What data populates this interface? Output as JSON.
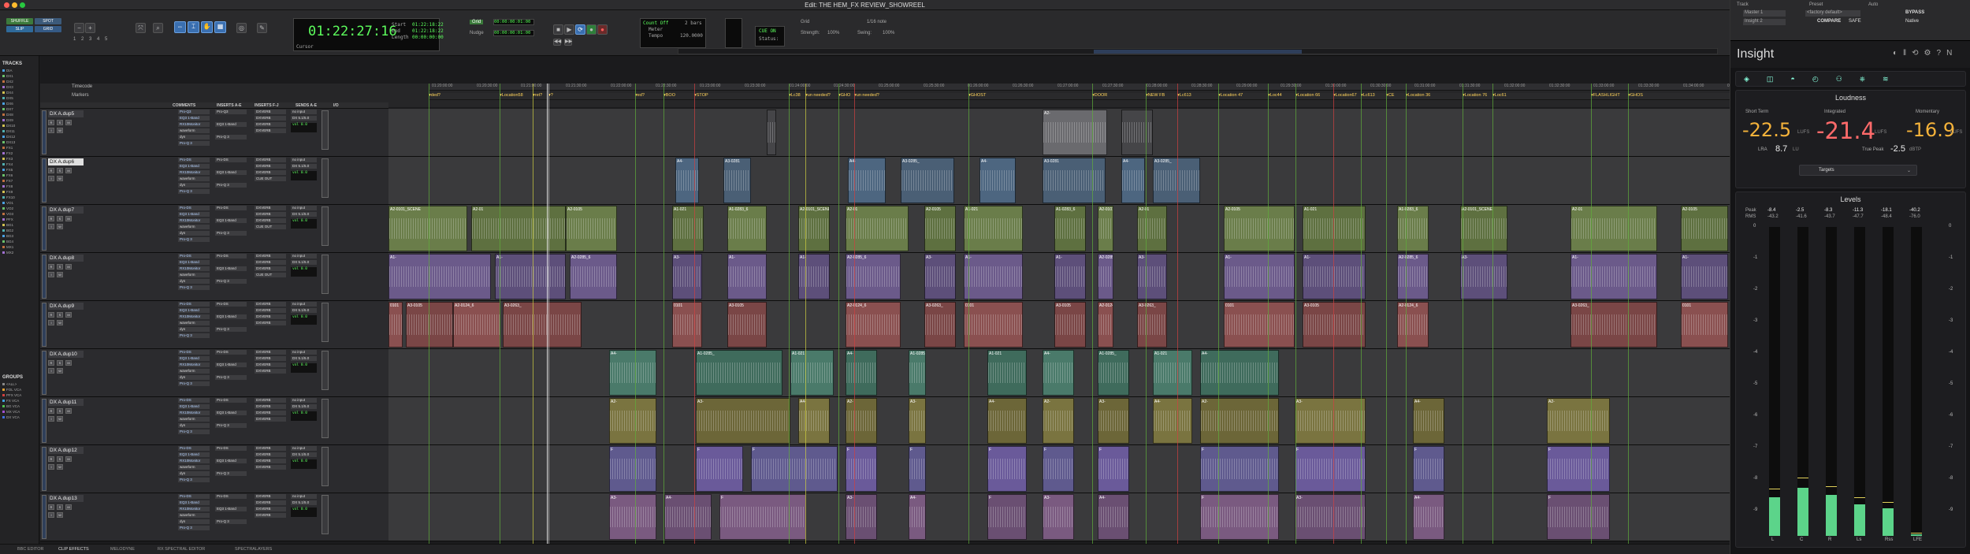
{
  "window": {
    "title": "Edit: THE HEM_FX REVIEW_SHOWREEL"
  },
  "toolbar": {
    "modes": [
      "SHUFFLE",
      "SPOT",
      "SLIP",
      "GRID"
    ],
    "counter_main": "01:22:27:16",
    "counter_cursor_label": "Cursor",
    "start_label": "Start",
    "end_label": "End",
    "length_label": "Length",
    "start": "01:22:18:22",
    "end": "01:22:18:22",
    "length": "00:00:00:00",
    "nudge_label": "Nudge",
    "grid_label": "Grid",
    "nudge_value": "00:00:00:01:00",
    "grid_value": "00:00:00:01:00",
    "count_off": "Count Off",
    "meter": "Meter",
    "tempo": "Tempo",
    "bars": "2 bars",
    "tempo_val": "120.0000",
    "grid_rate": "1/16 note",
    "strength": "Strength:",
    "strength_val": "100%",
    "swing": "Swing:",
    "swing_val": "100%",
    "cue_on": "CUE ON",
    "status": "Status:",
    "numbers": [
      "1",
      "2",
      "3",
      "4",
      "5"
    ]
  },
  "left_panel": {
    "tracks_title": "TRACKS",
    "track_list": [
      "DIA",
      "DX1",
      "DX2",
      "DX3",
      "DX4",
      "DX5",
      "DX6",
      "DX7",
      "DX8",
      "DX9",
      "DX10",
      "DX11",
      "DX12",
      "DX13",
      "FX1",
      "FX2",
      "FX3",
      "FX4",
      "FX5",
      "FX6",
      "FX7",
      "FX8",
      "FX9",
      "FX10",
      "VO1",
      "VO2",
      "VO3",
      "PFX",
      "BG1",
      "BG2",
      "BG3",
      "BG4",
      "MX1",
      "MX2"
    ],
    "groups_title": "GROUPS",
    "groups": [
      "<ALL>",
      "FOL VCA",
      "PFX VCA",
      "FX VCA",
      "BG VCA",
      "MX VCA",
      "DX VCA"
    ]
  },
  "rulers": {
    "timecode": "Timecode",
    "markers": "Markers"
  },
  "ruler_ticks": [
    "01:20:00:00",
    "01:20:30:00",
    "01:21:00:00",
    "01:21:30:00",
    "01:22:00:00",
    "01:22:30:00",
    "01:23:00:00",
    "01:23:30:00",
    "01:24:00:00",
    "01:24:30:00",
    "01:25:00:00",
    "01:25:30:00",
    "01:26:00:00",
    "01:26:30:00",
    "01:27:00:00",
    "01:27:30:00",
    "01:28:00:00",
    "01:28:30:00",
    "01:29:00:00",
    "01:29:30:00",
    "01:30:00:00",
    "01:30:30:00",
    "01:31:00:00",
    "01:31:30:00",
    "01:32:00:00",
    "01:32:30:00",
    "01:33:00:00",
    "01:33:30:00",
    "01:34:00:00",
    "01:34:30:00"
  ],
  "markers": [
    "ded?",
    "Location58",
    "ret?",
    "?",
    "ed?",
    "BOO",
    "STOP",
    "Lc38",
    "un needed?",
    "GHO",
    "un needed?",
    "GHOST",
    "DOOR",
    "NEW FB",
    "Lc613",
    "Location 47",
    "Loc44",
    "Location 66",
    "Location67",
    "Lc613",
    "CE",
    "Location 36",
    "Location 76",
    "Loc61",
    "FLASHLIGHT",
    "GHOS"
  ],
  "columns": {
    "comments": "COMMENTS",
    "inserts_ae": "INSERTS A-E",
    "inserts_fj": "INSERTS F-J",
    "sends": "SENDS A-E",
    "io": "I/O"
  },
  "tracks": [
    {
      "name": "DX A.dup5",
      "inserts": [
        "Pro-Q3",
        "EQ3 1-Band",
        "RX10Monitor",
        "waveform",
        "dyn",
        "Pro-Q 3"
      ],
      "sends": [
        "DXVERB",
        "DXVERB",
        "DXVERB",
        "DXVERB"
      ],
      "io": [
        "no input",
        "DX 5.1/5.0",
        "vol",
        "pan"
      ],
      "vol": "0.0",
      "clips": [
        "",
        "A2-",
        "",
        "A2-"
      ]
    },
    {
      "name": "DX A.dup6",
      "inserts": [
        "Pro-DS",
        "EQ3 1-Band",
        "RX10Monitor",
        "waveform",
        "dyn",
        "Pro-Q 3"
      ],
      "sends": [
        "DXVERB",
        "DXVERB",
        "DXVERB",
        "CUE OUT"
      ],
      "io": [
        "no input",
        "DX 5.1/5.0",
        "vol",
        "pan"
      ],
      "vol": "0.0",
      "clips": [
        "A4-",
        "A3-0281",
        "A4-",
        "A3-0285_"
      ]
    },
    {
      "name": "DX A.dup7",
      "inserts": [
        "Pro-DS",
        "EQ3 1-Band",
        "RX10Monitor",
        "waveform",
        "dyn",
        "Pro-Q 3"
      ],
      "sends": [
        "DXVERB",
        "DXVERB",
        "DXVERB",
        "CUE OUT"
      ],
      "io": [
        "no input",
        "DX 5.1/5.0",
        "vol",
        "pan"
      ],
      "vol": "0.0",
      "clips": [
        "A2-0101_SCENE",
        "A2-01",
        "A2-0105",
        "A1-021",
        "A1-0283_6"
      ]
    },
    {
      "name": "DX A.dup8",
      "inserts": [
        "Pro-DS",
        "EQ3 1-Band",
        "RX10Monitor",
        "waveform",
        "dyn",
        "Pro-Q 3"
      ],
      "sends": [
        "DXVERB",
        "DXVERB",
        "DXVERB",
        "CUE OUT"
      ],
      "io": [
        "no input",
        "DX 5.1/5.0",
        "vol",
        "pan"
      ],
      "vol": "0.0",
      "clips": [
        "A1-",
        "A1-",
        "A2-0285_6",
        "A3-"
      ]
    },
    {
      "name": "DX A.dup9",
      "inserts": [
        "Pro-DS",
        "EQ3 1-Band",
        "RX10Monitor",
        "waveform",
        "dyn",
        "Pro-Q 3"
      ],
      "sends": [
        "DXVERB",
        "DXVERB",
        "DXVERB",
        "DXVERB"
      ],
      "io": [
        "no input",
        "DX 5.1/5.0",
        "vol",
        "pan"
      ],
      "vol": "0.0",
      "clips": [
        "0101",
        "A3-0105",
        "A2-0124_6",
        "A3-0263_"
      ]
    },
    {
      "name": "DX A.dup10",
      "inserts": [
        "Pro-DS",
        "EQ3 1-Band",
        "RX10Monitor",
        "waveform",
        "dyn",
        "Pro-Q 3"
      ],
      "sends": [
        "DXVERB",
        "DXVERB",
        "DXVERB",
        "DXVERB"
      ],
      "io": [
        "no input",
        "DX 5.1/5.0",
        "vol",
        "pan"
      ],
      "vol": "0.0",
      "clips": [
        "A4-",
        "A1-0285_",
        "A1-021"
      ]
    },
    {
      "name": "DX A.dup11",
      "inserts": [
        "Pro-DS",
        "EQ3 1-Band",
        "RX10Monitor",
        "waveform",
        "dyn",
        "Pro-Q 3"
      ],
      "sends": [
        "DXVERB",
        "DXVERB",
        "DXVERB",
        "DXVERB"
      ],
      "io": [
        "no input",
        "DX 5.1/5.0",
        "vol",
        "pan"
      ],
      "vol": "0.0",
      "clips": [
        "A2-",
        "A3-",
        "A4-"
      ]
    },
    {
      "name": "DX A.dup12",
      "inserts": [
        "Pro-DS",
        "EQ3 1-Band",
        "RX10Monitor",
        "waveform",
        "dyn",
        "Pro-Q 3"
      ],
      "sends": [
        "DXVERB",
        "DXVERB",
        "DXVERB",
        "DXVERB"
      ],
      "io": [
        "no input",
        "DX 5.1/5.0",
        "vol",
        "pan"
      ],
      "vol": "0.0",
      "clips": [
        "F",
        "F",
        "F"
      ]
    },
    {
      "name": "DX A.dup13",
      "inserts": [
        "Pro-DS",
        "EQ3 1-Band",
        "RX10Monitor",
        "waveform",
        "dyn",
        "Pro-Q 3"
      ],
      "sends": [
        "DXVERB",
        "DXVERB",
        "DXVERB",
        "DXVERB"
      ],
      "io": [
        "no input",
        "DX 5.1/5.0",
        "vol",
        "pan"
      ],
      "vol": "0.0",
      "clips": [
        "A3-",
        "A4-",
        "F"
      ]
    }
  ],
  "bottom_tabs": [
    "BBC EDITOR",
    "CLIP EFFECTS",
    "MELODYNE",
    "RX SPECTRAL EDITOR",
    "SPECTRALAYERS"
  ],
  "insight": {
    "track_label": "Track",
    "preset_label": "Preset",
    "auto_label": "Auto",
    "track": "Master 1",
    "insert": "Insight 2",
    "preset": "<factory default>",
    "compare": "COMPARE",
    "safe": "SAFE",
    "bypass": "BYPASS",
    "native": "Native",
    "title": "Insight",
    "loudness": {
      "title": "Loudness",
      "short_term_label": "Short Term",
      "integrated_label": "Integrated",
      "momentary_label": "Momentary",
      "short_term": "-22.5",
      "integrated": "-21.4",
      "momentary": "-16.9",
      "unit": "LUFS",
      "lra_label": "LRA",
      "lra": "8.7",
      "lra_unit": "LU",
      "true_peak_label": "True Peak",
      "true_peak": "-2.5",
      "tp_unit": "dBTP",
      "targets": "Targets"
    },
    "levels": {
      "title": "Levels",
      "peak_label": "Peak",
      "rms_label": "RMS",
      "channels": [
        "L",
        "C",
        "R",
        "Ls",
        "Rss",
        "LFE"
      ],
      "peak": [
        "-8.4",
        "-2.5",
        "-8.3",
        "-11.3",
        "-18.1",
        "-40.2"
      ],
      "rms": [
        "-43.2",
        "-41.6",
        "-43.7",
        "-47.7",
        "-48.4",
        "-76.0"
      ],
      "level": [
        0.42,
        0.52,
        0.44,
        0.34,
        0.3,
        0.02
      ],
      "scale": [
        "0",
        "-1",
        "-2",
        "-3",
        "-4",
        "-6",
        "-8"
      ]
    }
  },
  "colors": {
    "accent": "#f4b23a",
    "meter": "#5cd48a",
    "clip_green": "#6a7d4a",
    "clip_purple": "#6b5a8a",
    "clip_red": "#8a5050",
    "clip_yellow": "#7a7440",
    "clip_blue": "#4d6680",
    "clip_teal": "#4a7a6a"
  }
}
